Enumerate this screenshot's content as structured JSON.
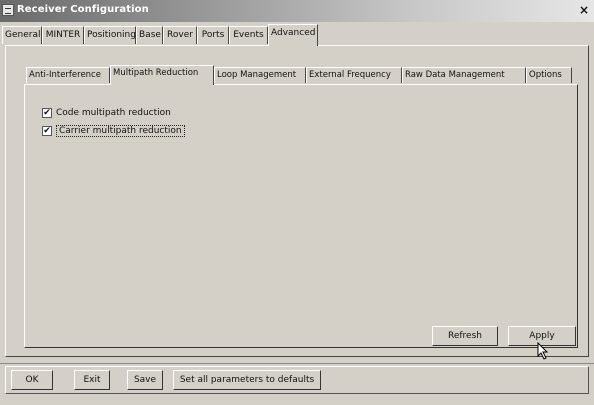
{
  "window": {
    "title": "Receiver Configuration",
    "close_symbol": "×"
  },
  "main_tabs": [
    {
      "label": "General"
    },
    {
      "label": "MINTER"
    },
    {
      "label": "Positioning"
    },
    {
      "label": "Base"
    },
    {
      "label": "Rover"
    },
    {
      "label": "Ports"
    },
    {
      "label": "Events"
    },
    {
      "label": "Advanced"
    }
  ],
  "sub_tabs": [
    {
      "label": "Anti-Interference"
    },
    {
      "label": "Multipath Reduction"
    },
    {
      "label": "Loop Management"
    },
    {
      "label": "External Frequency"
    },
    {
      "label": "Raw Data Management"
    },
    {
      "label": "Options"
    }
  ],
  "options": {
    "code_multipath": {
      "label": "Code multipath reduction",
      "checked": true,
      "mark": "✔"
    },
    "carrier_multipath": {
      "label": "Carrier multipath reduction",
      "checked": true,
      "mark": "✔"
    }
  },
  "panel_buttons": {
    "refresh": "Refresh",
    "apply": "Apply"
  },
  "footer_buttons": {
    "ok": "OK",
    "exit": "Exit",
    "save": "Save",
    "defaults": "Set all parameters to defaults"
  }
}
